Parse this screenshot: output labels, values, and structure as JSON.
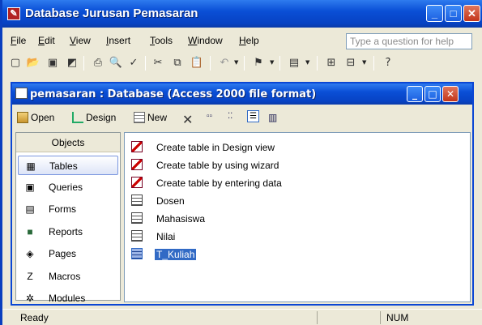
{
  "app": {
    "title": "Database Jurusan Pemasaran"
  },
  "window_buttons": {
    "minimize": "_",
    "maximize": "□",
    "close": "✕"
  },
  "menu": [
    "File",
    "Edit",
    "View",
    "Insert",
    "Tools",
    "Window",
    "Help"
  ],
  "menu_underline": [
    "F",
    "E",
    "V",
    "I",
    "T",
    "W",
    "H"
  ],
  "help_box": {
    "placeholder": "Type a question for help"
  },
  "db_window": {
    "title": "pemasaran : Database (Access 2000 file format)",
    "toolbar": {
      "open": "Open",
      "design": "Design",
      "new": "New"
    }
  },
  "objects": {
    "header": "Objects",
    "items": [
      {
        "label": "Tables",
        "icon": "table-icon"
      },
      {
        "label": "Queries",
        "icon": "query-icon"
      },
      {
        "label": "Forms",
        "icon": "form-icon"
      },
      {
        "label": "Reports",
        "icon": "report-icon"
      },
      {
        "label": "Pages",
        "icon": "page-icon"
      },
      {
        "label": "Macros",
        "icon": "macro-icon"
      },
      {
        "label": "Modules",
        "icon": "module-icon"
      }
    ],
    "selected": "Tables"
  },
  "list": [
    {
      "label": "Create table in Design view",
      "icon": "wizard-icon"
    },
    {
      "label": "Create table by using wizard",
      "icon": "wizard-icon"
    },
    {
      "label": "Create table by entering data",
      "icon": "wizard-icon"
    },
    {
      "label": "Dosen",
      "icon": "table-icon"
    },
    {
      "label": "Mahasiswa",
      "icon": "table-icon"
    },
    {
      "label": "Nilai",
      "icon": "table-icon"
    },
    {
      "label": "T_Kuliah",
      "icon": "table-icon",
      "selected": true
    }
  ],
  "status": {
    "left": "Ready",
    "num": "NUM"
  }
}
